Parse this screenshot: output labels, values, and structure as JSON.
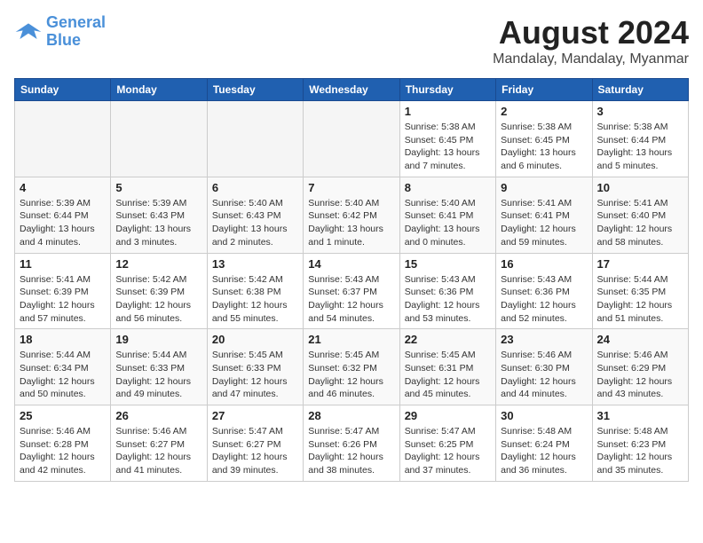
{
  "logo": {
    "line1": "General",
    "line2": "Blue"
  },
  "title": "August 2024",
  "subtitle": "Mandalay, Mandalay, Myanmar",
  "days_of_week": [
    "Sunday",
    "Monday",
    "Tuesday",
    "Wednesday",
    "Thursday",
    "Friday",
    "Saturday"
  ],
  "weeks": [
    [
      {
        "day": "",
        "empty": true
      },
      {
        "day": "",
        "empty": true
      },
      {
        "day": "",
        "empty": true
      },
      {
        "day": "",
        "empty": true
      },
      {
        "day": "1",
        "sunrise": "5:38 AM",
        "sunset": "6:45 PM",
        "daylight": "13 hours and 7 minutes."
      },
      {
        "day": "2",
        "sunrise": "5:38 AM",
        "sunset": "6:45 PM",
        "daylight": "13 hours and 6 minutes."
      },
      {
        "day": "3",
        "sunrise": "5:38 AM",
        "sunset": "6:44 PM",
        "daylight": "13 hours and 5 minutes."
      }
    ],
    [
      {
        "day": "4",
        "sunrise": "5:39 AM",
        "sunset": "6:44 PM",
        "daylight": "13 hours and 4 minutes."
      },
      {
        "day": "5",
        "sunrise": "5:39 AM",
        "sunset": "6:43 PM",
        "daylight": "13 hours and 3 minutes."
      },
      {
        "day": "6",
        "sunrise": "5:40 AM",
        "sunset": "6:43 PM",
        "daylight": "13 hours and 2 minutes."
      },
      {
        "day": "7",
        "sunrise": "5:40 AM",
        "sunset": "6:42 PM",
        "daylight": "13 hours and 1 minute."
      },
      {
        "day": "8",
        "sunrise": "5:40 AM",
        "sunset": "6:41 PM",
        "daylight": "13 hours and 0 minutes."
      },
      {
        "day": "9",
        "sunrise": "5:41 AM",
        "sunset": "6:41 PM",
        "daylight": "12 hours and 59 minutes."
      },
      {
        "day": "10",
        "sunrise": "5:41 AM",
        "sunset": "6:40 PM",
        "daylight": "12 hours and 58 minutes."
      }
    ],
    [
      {
        "day": "11",
        "sunrise": "5:41 AM",
        "sunset": "6:39 PM",
        "daylight": "12 hours and 57 minutes."
      },
      {
        "day": "12",
        "sunrise": "5:42 AM",
        "sunset": "6:39 PM",
        "daylight": "12 hours and 56 minutes."
      },
      {
        "day": "13",
        "sunrise": "5:42 AM",
        "sunset": "6:38 PM",
        "daylight": "12 hours and 55 minutes."
      },
      {
        "day": "14",
        "sunrise": "5:43 AM",
        "sunset": "6:37 PM",
        "daylight": "12 hours and 54 minutes."
      },
      {
        "day": "15",
        "sunrise": "5:43 AM",
        "sunset": "6:36 PM",
        "daylight": "12 hours and 53 minutes."
      },
      {
        "day": "16",
        "sunrise": "5:43 AM",
        "sunset": "6:36 PM",
        "daylight": "12 hours and 52 minutes."
      },
      {
        "day": "17",
        "sunrise": "5:44 AM",
        "sunset": "6:35 PM",
        "daylight": "12 hours and 51 minutes."
      }
    ],
    [
      {
        "day": "18",
        "sunrise": "5:44 AM",
        "sunset": "6:34 PM",
        "daylight": "12 hours and 50 minutes."
      },
      {
        "day": "19",
        "sunrise": "5:44 AM",
        "sunset": "6:33 PM",
        "daylight": "12 hours and 49 minutes."
      },
      {
        "day": "20",
        "sunrise": "5:45 AM",
        "sunset": "6:33 PM",
        "daylight": "12 hours and 47 minutes."
      },
      {
        "day": "21",
        "sunrise": "5:45 AM",
        "sunset": "6:32 PM",
        "daylight": "12 hours and 46 minutes."
      },
      {
        "day": "22",
        "sunrise": "5:45 AM",
        "sunset": "6:31 PM",
        "daylight": "12 hours and 45 minutes."
      },
      {
        "day": "23",
        "sunrise": "5:46 AM",
        "sunset": "6:30 PM",
        "daylight": "12 hours and 44 minutes."
      },
      {
        "day": "24",
        "sunrise": "5:46 AM",
        "sunset": "6:29 PM",
        "daylight": "12 hours and 43 minutes."
      }
    ],
    [
      {
        "day": "25",
        "sunrise": "5:46 AM",
        "sunset": "6:28 PM",
        "daylight": "12 hours and 42 minutes."
      },
      {
        "day": "26",
        "sunrise": "5:46 AM",
        "sunset": "6:27 PM",
        "daylight": "12 hours and 41 minutes."
      },
      {
        "day": "27",
        "sunrise": "5:47 AM",
        "sunset": "6:27 PM",
        "daylight": "12 hours and 39 minutes."
      },
      {
        "day": "28",
        "sunrise": "5:47 AM",
        "sunset": "6:26 PM",
        "daylight": "12 hours and 38 minutes."
      },
      {
        "day": "29",
        "sunrise": "5:47 AM",
        "sunset": "6:25 PM",
        "daylight": "12 hours and 37 minutes."
      },
      {
        "day": "30",
        "sunrise": "5:48 AM",
        "sunset": "6:24 PM",
        "daylight": "12 hours and 36 minutes."
      },
      {
        "day": "31",
        "sunrise": "5:48 AM",
        "sunset": "6:23 PM",
        "daylight": "12 hours and 35 minutes."
      }
    ]
  ]
}
